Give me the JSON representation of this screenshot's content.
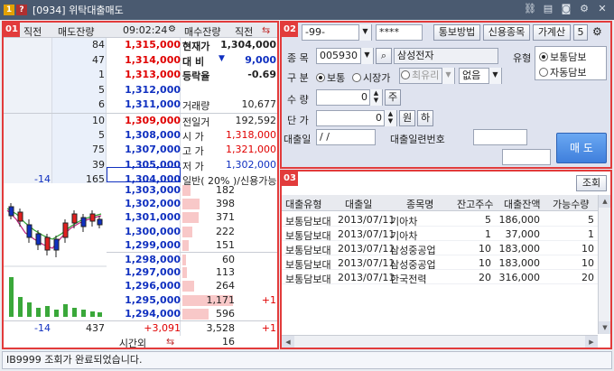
{
  "window": {
    "badge1": "1",
    "badge2": "?",
    "title": "[0934] 위탁대출매도"
  },
  "orderbook": {
    "panel_no": "01",
    "headers": {
      "h1": "직전",
      "h2": "매도잔량",
      "time": "09:02:24",
      "h3": "매수잔량",
      "h4": "직전"
    },
    "ask_rows": [
      {
        "prev": "",
        "qty": "84",
        "price": "1,315,000",
        "label": "현재가",
        "value": "1,304,000"
      },
      {
        "prev": "",
        "qty": "47",
        "price": "1,314,000",
        "label": "대 비",
        "value": "9,000"
      },
      {
        "prev": "",
        "qty": "1",
        "price": "1,313,000",
        "label": "등락율",
        "value": "-0.69"
      },
      {
        "prev": "",
        "qty": "5",
        "price": "1,312,000",
        "label": "",
        "value": ""
      },
      {
        "prev": "",
        "qty": "6",
        "price": "1,311,000",
        "label": "거래량",
        "value": "10,677"
      },
      {
        "prev": "",
        "qty": "10",
        "price": "1,309,000",
        "label": "전일거",
        "value": "192,592"
      },
      {
        "prev": "",
        "qty": "5",
        "price": "1,308,000",
        "label": "시 가",
        "value": "1,318,000"
      },
      {
        "prev": "",
        "qty": "75",
        "price": "1,307,000",
        "label": "고 가",
        "value": "1,321,000"
      },
      {
        "prev": "",
        "qty": "39",
        "price": "1,305,000",
        "label": "저 가",
        "value": "1,302,000"
      },
      {
        "prev": "-14",
        "qty": "165",
        "price": "1,304,000",
        "label": "일반( 20% )/신용가능",
        "value": ""
      }
    ],
    "bid_rows": [
      {
        "price": "1,303,000",
        "qty": "182",
        "prev": ""
      },
      {
        "price": "1,302,000",
        "qty": "398",
        "prev": ""
      },
      {
        "price": "1,301,000",
        "qty": "371",
        "prev": ""
      },
      {
        "price": "1,300,000",
        "qty": "222",
        "prev": ""
      },
      {
        "price": "1,299,000",
        "qty": "151",
        "prev": ""
      },
      {
        "price": "1,298,000",
        "qty": "60",
        "prev": ""
      },
      {
        "price": "1,297,000",
        "qty": "113",
        "prev": ""
      },
      {
        "price": "1,296,000",
        "qty": "264",
        "prev": ""
      },
      {
        "price": "1,295,000",
        "qty": "1,171",
        "prev": "+1"
      },
      {
        "price": "1,294,000",
        "qty": "596",
        "prev": ""
      }
    ],
    "bid_bar_scale_max": 1171,
    "footer": {
      "prev_total": "-14",
      "ask_total": "437",
      "change": "+3,091",
      "bid_total": "3,528",
      "bid_change": "+1"
    },
    "after_hours": {
      "label": "시간외",
      "value": "16"
    }
  },
  "order": {
    "panel_no": "02",
    "account": "-99-",
    "password": "****",
    "btn_collateral": "통보방법",
    "btn_credit": "신용종목",
    "btn_calc": "가계산",
    "btn_five": "5",
    "stock_label": "종 목",
    "stock_code": "005930",
    "stock_name": "삼성전자",
    "type_label": "유형",
    "type_options": [
      "보통담보",
      "자동담보"
    ],
    "kind_label": "구 분",
    "kind_options": [
      "보통",
      "시장가",
      "최유리"
    ],
    "kind_extra": "없음",
    "qty_label": "수 량",
    "qty_value": "0",
    "qty_unit": "주",
    "price_label": "단 가",
    "price_value": "0",
    "price_unit": "원",
    "price_down": "하",
    "loan_date_label": "대출일",
    "loan_date_value": "/  /",
    "loan_serial_label": "대출일련번호",
    "submit": "매 도"
  },
  "loans": {
    "panel_no": "03",
    "query_button": "조회",
    "columns": [
      "대출유형",
      "대출일",
      "종목명",
      "잔고주수",
      "대출잔액",
      "가능수량"
    ],
    "rows": [
      [
        "보통담보대",
        "2013/07/11",
        "기아차",
        "5",
        "186,000",
        "5"
      ],
      [
        "보통담보대",
        "2013/07/11",
        "기아차",
        "1",
        "37,000",
        "1"
      ],
      [
        "보통담보대",
        "2013/07/11",
        "삼성중공업",
        "10",
        "183,000",
        "10"
      ],
      [
        "보통담보대",
        "2013/07/11",
        "삼성중공업",
        "10",
        "183,000",
        "10"
      ],
      [
        "보통담보대",
        "2013/07/11",
        "한국전력",
        "20",
        "316,000",
        "20"
      ]
    ]
  },
  "status": {
    "message": "IB9999  조회가 완료되었습니다."
  },
  "colors": {
    "accent_red": "#e23b3b",
    "price_red": "#e00000",
    "price_blue": "#1030c0",
    "submit_blue": "#3f7fdc"
  }
}
